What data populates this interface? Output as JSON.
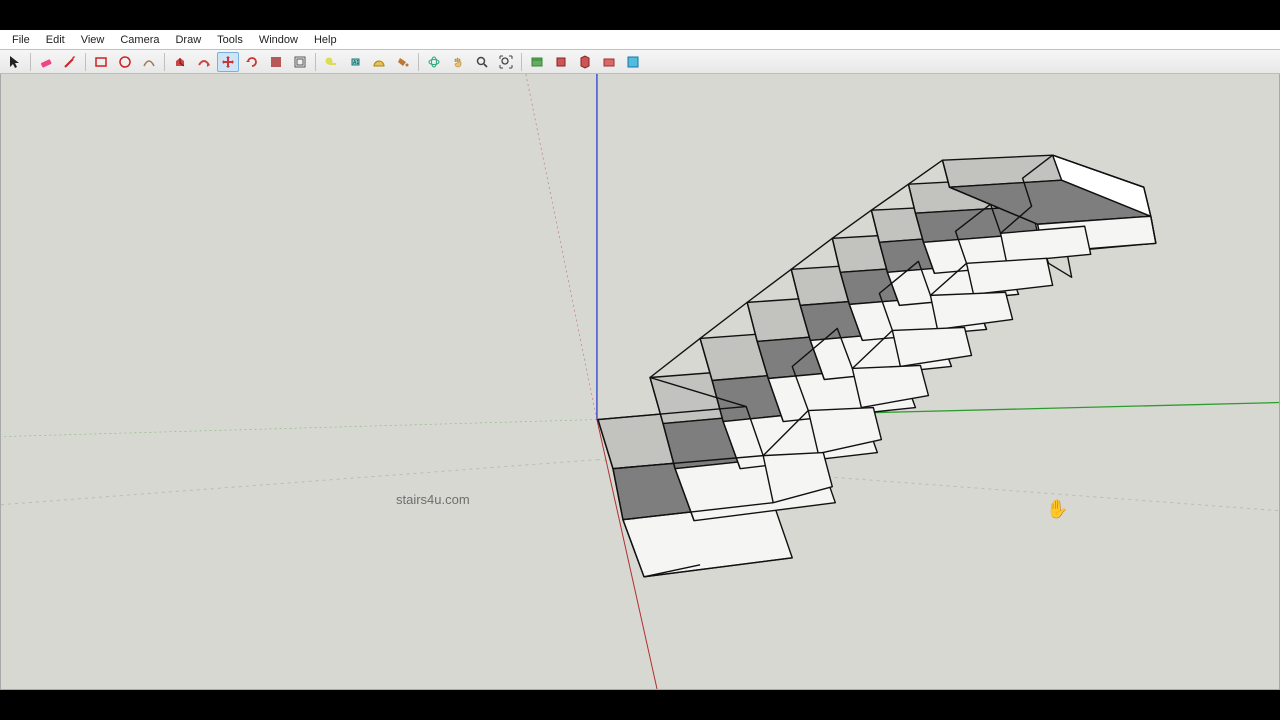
{
  "menu": {
    "items": [
      "File",
      "Edit",
      "View",
      "Camera",
      "Draw",
      "Tools",
      "Window",
      "Help"
    ]
  },
  "toolbar": {
    "tools": [
      {
        "name": "select-icon",
        "title": "Select"
      },
      {
        "name": "eraser-icon",
        "title": "Eraser"
      },
      {
        "name": "line-icon",
        "title": "Line"
      },
      {
        "name": "rectangle-icon",
        "title": "Rectangle"
      },
      {
        "name": "circle-icon",
        "title": "Circle"
      },
      {
        "name": "arc-icon",
        "title": "Arc"
      },
      {
        "name": "pushpull-icon",
        "title": "Push/Pull"
      },
      {
        "name": "followme-icon",
        "title": "Follow Me"
      },
      {
        "name": "move-icon",
        "title": "Move",
        "active": true
      },
      {
        "name": "rotate-icon",
        "title": "Rotate"
      },
      {
        "name": "scale-icon",
        "title": "Offset"
      },
      {
        "name": "offset-icon",
        "title": "Scale"
      },
      {
        "name": "tape-icon",
        "title": "Tape Measure"
      },
      {
        "name": "dimension-icon",
        "title": "Dimension"
      },
      {
        "name": "protractor-icon",
        "title": "Protractor"
      },
      {
        "name": "paint-icon",
        "title": "Paint Bucket"
      },
      {
        "name": "orbit-icon",
        "title": "Orbit"
      },
      {
        "name": "pan-icon",
        "title": "Pan"
      },
      {
        "name": "zoom-icon",
        "title": "Zoom"
      },
      {
        "name": "zoom-extents-icon",
        "title": "Zoom Extents"
      },
      {
        "name": "previous-icon",
        "title": "Previous"
      },
      {
        "name": "next-icon",
        "title": "Walk"
      },
      {
        "name": "lookaround-icon",
        "title": "Look Around"
      },
      {
        "name": "section-icon",
        "title": "Section"
      },
      {
        "name": "get-models-icon",
        "title": "Get Models"
      }
    ]
  },
  "viewport": {
    "watermark": "stairs4u.com",
    "axes": {
      "blue": "#2b3ecf",
      "green": "#2f9b2f",
      "red": "#b03030"
    },
    "horizon_dash": "#a9b59b"
  },
  "cursor_glyph": "✋"
}
